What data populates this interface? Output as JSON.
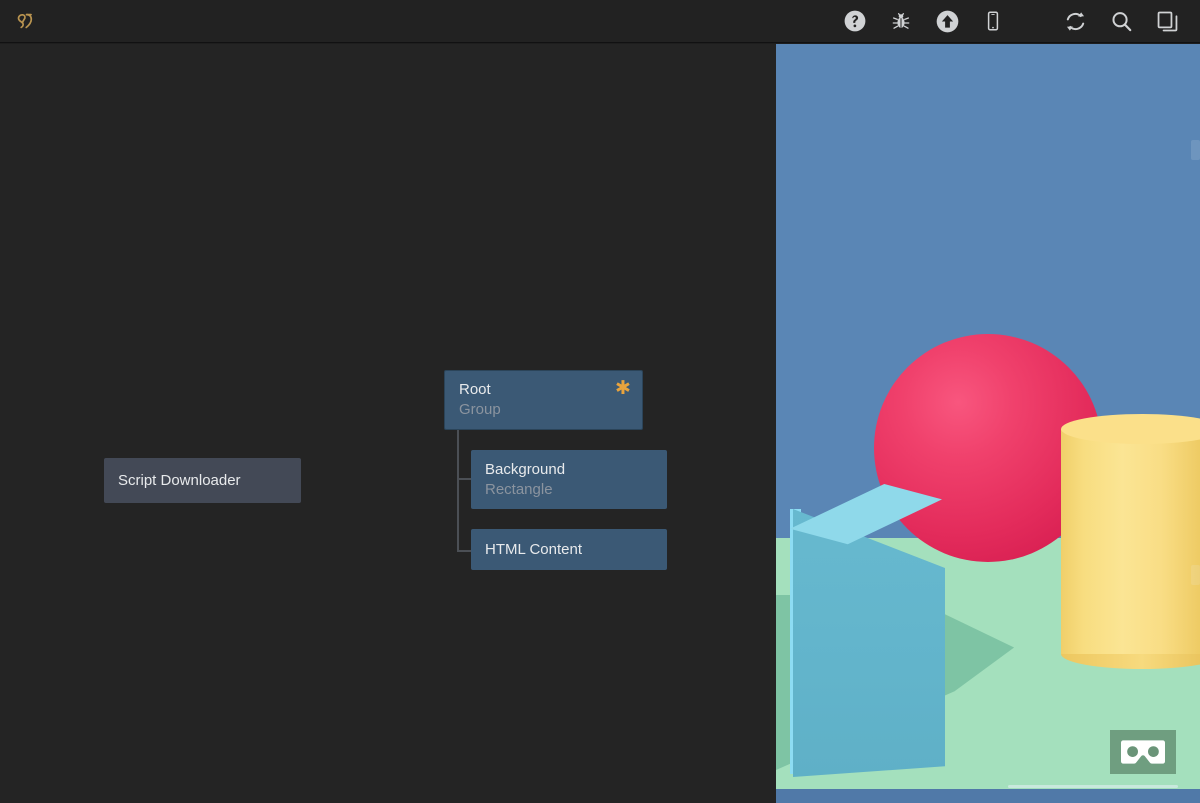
{
  "app": {
    "background_color": "#1e1e1e",
    "canvas_color": "#242424"
  },
  "toolbar": {
    "logo": {
      "name": "app-logo",
      "icon": "script-glyph-logo",
      "color": "#b99450"
    },
    "left_tools": [
      {
        "id": "help",
        "icon": "help-circle-icon",
        "label": "Help"
      },
      {
        "id": "debug",
        "icon": "bug-icon",
        "label": "Debug"
      },
      {
        "id": "upload",
        "icon": "upload-circle-icon",
        "label": "Publish"
      },
      {
        "id": "mobile",
        "icon": "mobile-phone-icon",
        "label": "Mobile Preview"
      }
    ],
    "right_tools": [
      {
        "id": "refresh",
        "icon": "refresh-sync-icon",
        "label": "Reload"
      },
      {
        "id": "search",
        "icon": "search-icon",
        "label": "Search"
      },
      {
        "id": "windows",
        "icon": "copy-windows-icon",
        "label": "Layout"
      }
    ],
    "icon_color": "#d0d2d4"
  },
  "canvas": {
    "detached_node": {
      "title": "Script Downloader",
      "background_color": "#434956",
      "title_color": "#e8eaec"
    },
    "tree": {
      "root": {
        "title": "Root",
        "subtitle": "Group",
        "badge_icon": "asterisk-star-icon",
        "badge_color": "#e8a33d",
        "background_color": "#3b5975"
      },
      "children": [
        {
          "title": "Background",
          "subtitle": "Rectangle",
          "background_color": "#3b5975"
        },
        {
          "title": "HTML Content",
          "subtitle": "",
          "background_color": "#3b5975"
        }
      ],
      "connector_color": "#4b4f55"
    }
  },
  "preview": {
    "name": "3d-scene-preview",
    "sky_color": "#5a86b5",
    "ground_color": "#a4e0bd",
    "objects": [
      {
        "shape": "sphere",
        "color": "#e8305f",
        "name": "pink-sphere"
      },
      {
        "shape": "box",
        "color": "#67b9cf",
        "name": "cyan-cube"
      },
      {
        "shape": "cylinder",
        "color": "#f7d87c",
        "name": "yellow-cylinder"
      }
    ],
    "vr_button": {
      "icon": "vr-cardboard-icon",
      "label": "Enter VR",
      "background_color": "rgba(104,148,119,0.88)"
    },
    "bottom_bar_color": "#5079a8"
  }
}
